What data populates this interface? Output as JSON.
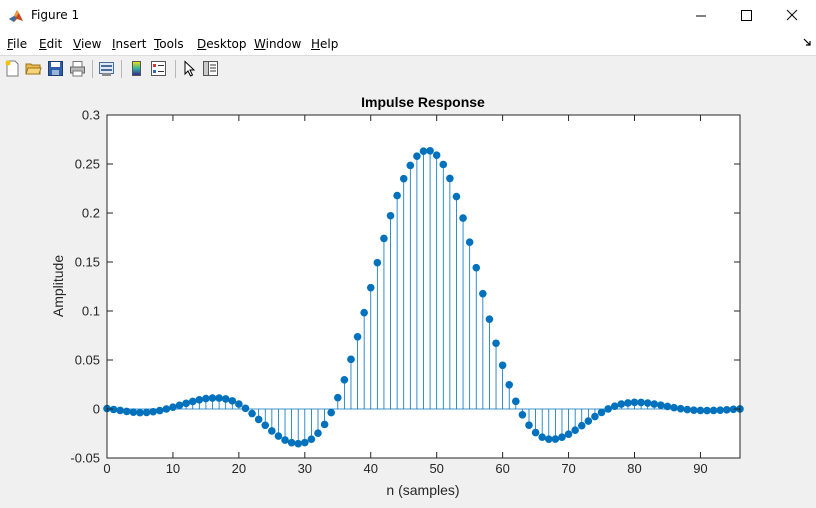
{
  "window": {
    "title": "Figure 1",
    "controls": [
      "minimize",
      "maximize",
      "close"
    ]
  },
  "menu": [
    "File",
    "Edit",
    "View",
    "Insert",
    "Tools",
    "Desktop",
    "Window",
    "Help"
  ],
  "toolbar_icons": [
    "new-figure-icon",
    "open-file-icon",
    "save-icon",
    "print-icon",
    "link-plot-icon",
    "colorbar-icon",
    "legend-icon",
    "edit-plot-arrow-icon",
    "property-inspector-icon"
  ],
  "colors": {
    "stem": "#0072bd",
    "axes": "#262626",
    "grid_bg": "#ffffff",
    "figure_bg": "#f0f0f0"
  },
  "chart_data": {
    "type": "stem",
    "title": "Impulse Response",
    "xlabel": "n (samples)",
    "ylabel": "Amplitude",
    "xlim": [
      0,
      96
    ],
    "ylim": [
      -0.05,
      0.3
    ],
    "xticks": [
      "0",
      "10",
      "20",
      "30",
      "40",
      "50",
      "60",
      "70",
      "80",
      "90"
    ],
    "yticks": [
      "-0.05",
      "0",
      "0.05",
      "0.1",
      "0.15",
      "0.2",
      "0.25",
      "0.3"
    ],
    "grid": false,
    "series": [
      {
        "x": [
          0,
          1,
          2,
          3,
          4,
          5,
          6,
          7,
          8,
          9,
          10,
          11,
          12,
          13,
          14,
          15,
          16,
          17,
          18,
          19,
          20,
          21,
          22,
          23,
          24,
          25,
          26,
          27,
          28,
          29,
          30,
          31,
          32,
          33,
          34,
          35,
          36,
          37,
          38,
          39,
          40,
          41,
          42,
          43,
          44,
          45,
          46,
          47,
          48,
          49,
          50,
          51,
          52,
          53,
          54,
          55,
          56,
          57,
          58,
          59,
          60,
          61,
          62,
          63,
          64,
          65,
          66,
          67,
          68,
          69,
          70,
          71,
          72,
          73,
          74,
          75,
          76,
          77,
          78,
          79,
          80,
          81,
          82,
          83,
          84,
          85,
          86,
          87,
          88,
          89,
          90,
          91,
          92,
          93,
          94,
          95,
          96
        ],
        "y": [
          0.0005,
          -0.0005,
          -0.0015,
          -0.0025,
          -0.0033,
          -0.0037,
          -0.0035,
          -0.0028,
          -0.0016,
          0.0,
          0.0018,
          0.0038,
          0.0058,
          0.0077,
          0.0094,
          0.0106,
          0.0112,
          0.0112,
          0.0103,
          0.0083,
          0.0051,
          0.0007,
          -0.0047,
          -0.0106,
          -0.0166,
          -0.0224,
          -0.0276,
          -0.0317,
          -0.0344,
          -0.0354,
          -0.0343,
          -0.0308,
          -0.0247,
          -0.0157,
          -0.0036,
          0.0116,
          0.0298,
          0.0507,
          0.0737,
          0.0983,
          0.1238,
          0.1493,
          0.1741,
          0.1972,
          0.2178,
          0.235,
          0.2485,
          0.258,
          0.2631,
          0.2635,
          0.259,
          0.2495,
          0.2353,
          0.2168,
          0.1948,
          0.1702,
          0.1442,
          0.1177,
          0.0917,
          0.0671,
          0.0446,
          0.0247,
          0.0078,
          -0.0059,
          -0.0165,
          -0.024,
          -0.0287,
          -0.0308,
          -0.0307,
          -0.0288,
          -0.0257,
          -0.0216,
          -0.017,
          -0.0123,
          -0.0077,
          -0.0035,
          0.0001,
          0.0029,
          0.005,
          0.0062,
          0.0068,
          0.0067,
          0.0061,
          0.0051,
          0.0039,
          0.0026,
          0.0014,
          0.0003,
          -0.0006,
          -0.0012,
          -0.0015,
          -0.0016,
          -0.0015,
          -0.0012,
          -0.0008,
          -0.0003,
          0.0001
        ]
      }
    ]
  }
}
